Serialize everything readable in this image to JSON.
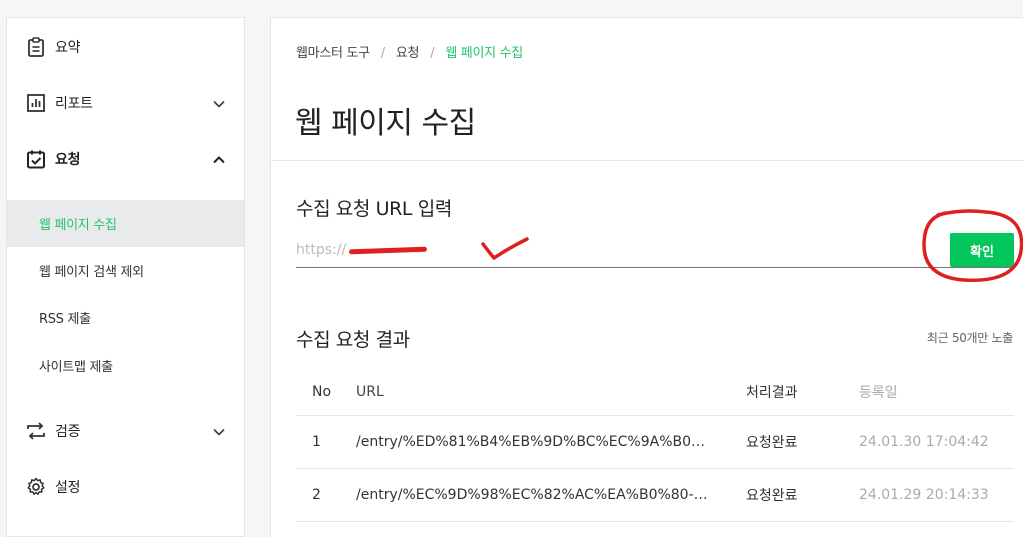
{
  "sidebar": {
    "items": [
      {
        "label": "요약",
        "icon": "clipboard-icon"
      },
      {
        "label": "리포트",
        "icon": "bar-chart-icon",
        "expandable": true,
        "expanded": false
      },
      {
        "label": "요청",
        "icon": "calendar-check-icon",
        "expandable": true,
        "expanded": true
      },
      {
        "label": "검증",
        "icon": "repeat-arrows-icon",
        "expandable": true,
        "expanded": false
      },
      {
        "label": "설정",
        "icon": "gear-icon"
      }
    ],
    "subitems": [
      {
        "label": "웹 페이지 수집",
        "active": true
      },
      {
        "label": "웹 페이지 검색 제외"
      },
      {
        "label": "RSS 제출"
      },
      {
        "label": "사이트맵 제출"
      }
    ]
  },
  "breadcrumb": {
    "items": [
      "웹마스터 도구",
      "요청",
      "웹 페이지 수집"
    ]
  },
  "page": {
    "title": "웹 페이지 수집"
  },
  "request_form": {
    "title": "수집 요청 URL 입력",
    "input_value": "https://",
    "confirm_label": "확인"
  },
  "results": {
    "title": "수집 요청 결과",
    "note": "최근 50개만 노출",
    "columns": [
      "No",
      "URL",
      "처리결과",
      "등록일"
    ],
    "rows": [
      {
        "no": "1",
        "url": "/entry/%ED%81%B4%EB%9D%BC%EC%9A%B0…",
        "status": "요청완료",
        "date": "24.01.30 17:04:42"
      },
      {
        "no": "2",
        "url": "/entry/%EC%9D%98%EC%82%AC%EA%B0%80-…",
        "status": "요청완료",
        "date": "24.01.29 20:14:33"
      }
    ]
  },
  "colors": {
    "accent": "#03c75a",
    "active_text": "#1ec66b",
    "annotation": "#e02020"
  }
}
